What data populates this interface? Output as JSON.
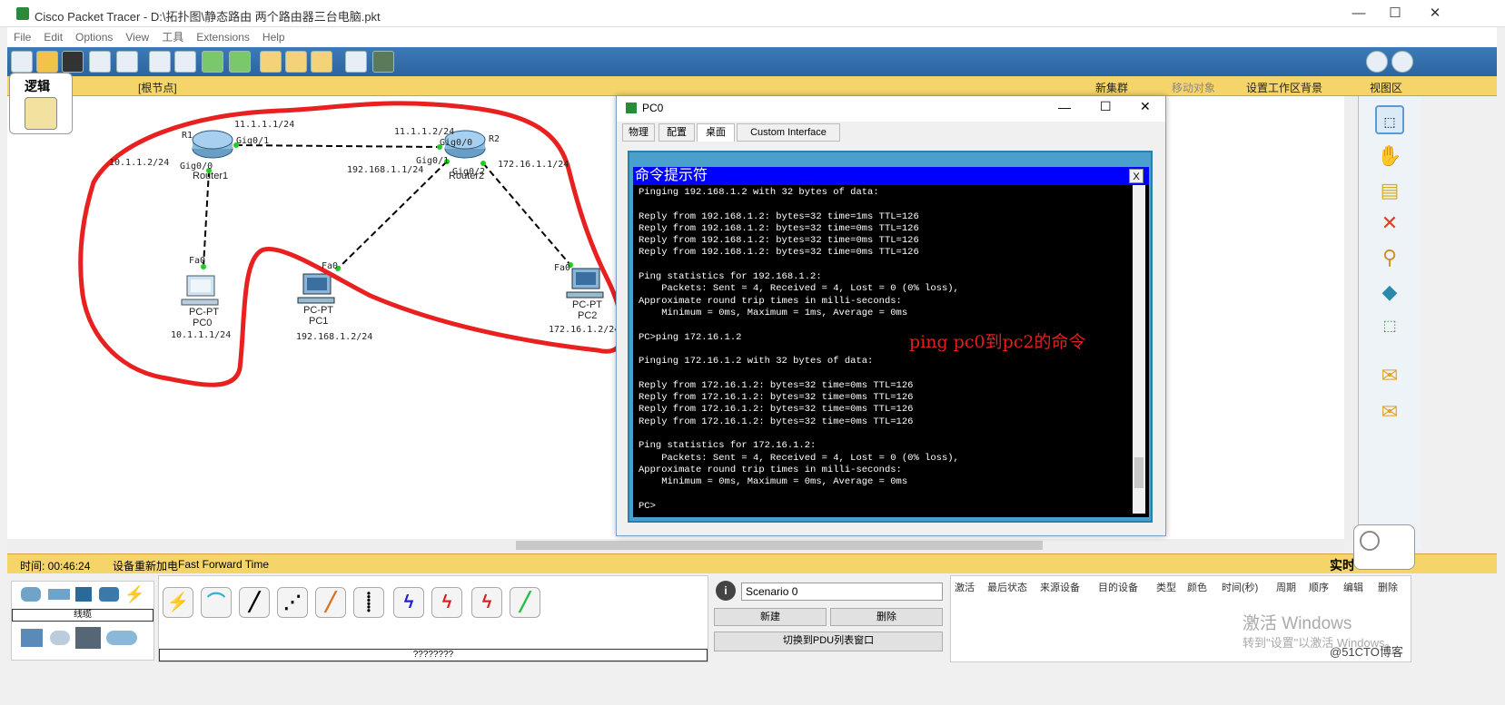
{
  "window": {
    "title": "Cisco Packet Tracer - D:\\拓扑图\\静态路由 两个路由器三台电脑.pkt",
    "min": "—",
    "max": "☐",
    "close": "✕"
  },
  "menu": [
    "File",
    "Edit",
    "Options",
    "View",
    "工具",
    "Extensions",
    "Help"
  ],
  "infobar": {
    "logic": "逻辑",
    "root": "[根节点]",
    "new_cluster": "新集群",
    "move_object": "移动对象",
    "bg": "设置工作区背景",
    "viewport": "视图区"
  },
  "topology": {
    "r1": {
      "name": "R1",
      "model": "Router1",
      "ip_top": "11.1.1.1/24",
      "port_top": "Gig0/1",
      "port_bottom": "Gig0/0",
      "ip_left": "10.1.1.2/24"
    },
    "r2": {
      "name": "R2",
      "model": "Router2",
      "ip_top": "11.1.1.2/24",
      "port_top": "Gig0/0",
      "port_left": "Gig0/1",
      "port_right": "Gig0/2",
      "ip_left": "192.168.1.1/24",
      "ip_right": "172.16.1.1/24"
    },
    "pc0": {
      "type": "PC-PT",
      "name": "PC0",
      "ip": "10.1.1.1/24",
      "port": "Fa0"
    },
    "pc1": {
      "type": "PC-PT",
      "name": "PC1",
      "ip": "192.168.1.2/24",
      "port": "Fa0"
    },
    "pc2": {
      "type": "PC-PT",
      "name": "PC2",
      "ip": "172.16.1.2/24",
      "port": "Fa0"
    }
  },
  "pc0window": {
    "title": "PC0",
    "tabs": [
      "物理",
      "配置",
      "桌面",
      "Custom Interface"
    ],
    "cmd_title": "命令提示符",
    "cmd_close": "X",
    "cmd_lines": [
      "Pinging 192.168.1.2 with 32 bytes of data:",
      "",
      "Reply from 192.168.1.2: bytes=32 time=1ms TTL=126",
      "Reply from 192.168.1.2: bytes=32 time=0ms TTL=126",
      "Reply from 192.168.1.2: bytes=32 time=0ms TTL=126",
      "Reply from 192.168.1.2: bytes=32 time=0ms TTL=126",
      "",
      "Ping statistics for 192.168.1.2:",
      "    Packets: Sent = 4, Received = 4, Lost = 0 (0% loss),",
      "Approximate round trip times in milli-seconds:",
      "    Minimum = 0ms, Maximum = 1ms, Average = 0ms",
      "",
      "PC>ping 172.16.1.2",
      "",
      "Pinging 172.16.1.2 with 32 bytes of data:",
      "",
      "Reply from 172.16.1.2: bytes=32 time=0ms TTL=126",
      "Reply from 172.16.1.2: bytes=32 time=0ms TTL=126",
      "Reply from 172.16.1.2: bytes=32 time=0ms TTL=126",
      "Reply from 172.16.1.2: bytes=32 time=0ms TTL=126",
      "",
      "Ping statistics for 172.16.1.2:",
      "    Packets: Sent = 4, Received = 4, Lost = 0 (0% loss),",
      "Approximate round trip times in milli-seconds:",
      "    Minimum = 0ms, Maximum = 0ms, Average = 0ms",
      "",
      "PC>"
    ],
    "annotation": "ping pc0到pc2的命令"
  },
  "status": {
    "time": "时间: 00:46:24",
    "power": "设备重新加电",
    "fft": "Fast Forward Time",
    "realtime": "实时"
  },
  "bottom": {
    "devtype_label": "线缆",
    "conn_label": "????????",
    "scenario": "Scenario 0",
    "new": "新建",
    "delete": "删除",
    "switch": "切换到PDU列表窗口"
  },
  "pdu_columns": [
    "激活",
    "最后状态",
    "来源设备",
    "目的设备",
    "类型",
    "颜色",
    "时间(秒)",
    "周期",
    "顺序",
    "编辑",
    "删除"
  ],
  "watermark": {
    "line1": "激活 Windows",
    "line2": "转到\"设置\"以激活 Windows。",
    "site": "@51CTO博客"
  },
  "colors": {
    "toolbar": "#2d64a0",
    "infobar": "#f5d56a",
    "cmd_bg": "#000000",
    "cmd_title": "#0000ff",
    "annotation": "#e02020",
    "hand_loop": "#e82020"
  }
}
